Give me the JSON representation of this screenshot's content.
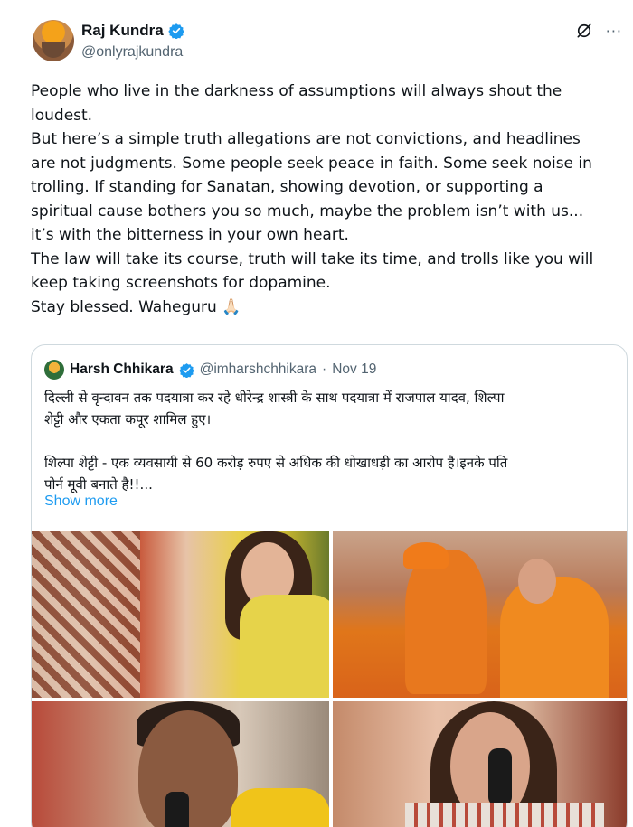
{
  "tweet": {
    "author_name": "Raj Kundra",
    "author_handle": "@onlyrajkundra",
    "icons": [
      "grok-icon",
      "more-icon"
    ],
    "more_icon_glyph": "···",
    "grok_icon_glyph": "⌀",
    "lines": [
      "People who live in the darkness of assumptions will always shout the",
      "loudest.",
      "But here’s a simple truth allegations are not convictions, and headlines",
      "are not judgments. Some people seek peace in faith. Some seek noise in",
      "trolling. If standing for Sanatan, showing devotion, or supporting a",
      "spiritual cause bothers you so much, maybe the problem isn’t with us...",
      "it’s with the bitterness in your own heart.",
      "The law will take its course, truth will take its time, and trolls like you will",
      "keep taking screenshots for dopamine.",
      "Stay blessed. Waheguru 🙏🏻"
    ]
  },
  "quoted": {
    "author_name": "Harsh Chhikara",
    "author_handle": "@imharshchhikara",
    "separator": "·",
    "date": "Nov 19",
    "lines": [
      "दिल्ली से वृन्दावन तक पदयात्रा कर रहे धीरेन्द्र शास्त्री के साथ पदयात्रा में राजपाल यादव, शिल्पा",
      "शेट्टी और एकता कपूर शामिल हुए।",
      "",
      "शिल्पा शेट्टी - एक व्यवसायी से 60 करोड़ रुपए से अधिक की धोखाधड़ी का आरोप है।इनके पति",
      "पोर्न मूवी बनाते है!!..."
    ],
    "show_more": "Show more"
  },
  "colors": {
    "text": "#0f1419",
    "secondary": "#536471",
    "link": "#1d9bf0",
    "verified": "#1d9bf0",
    "border": "#cfd9de"
  }
}
